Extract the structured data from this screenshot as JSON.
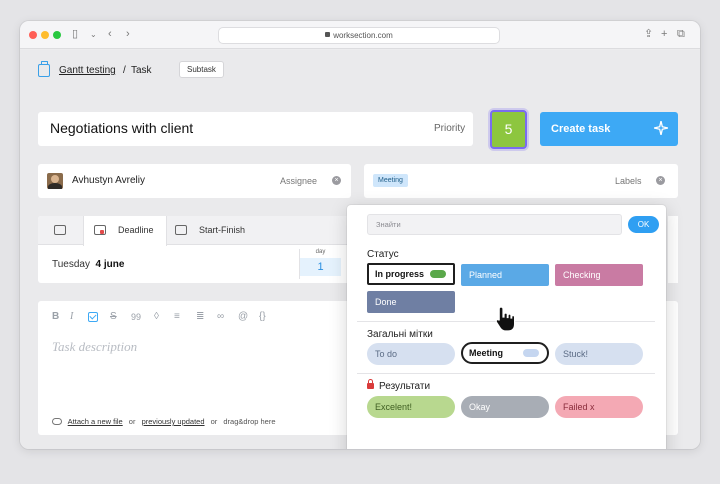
{
  "browser": {
    "url": "worksection.com"
  },
  "breadcrumb": {
    "project": "Gantt testing",
    "separator": "/",
    "current": "Task",
    "subtask_button": "Subtask"
  },
  "task": {
    "title": "Negotiations with client",
    "priority_label": "Priority",
    "priority_value": "5",
    "create_button": "Create task"
  },
  "assignee": {
    "name": "Avhustyn Avreliy",
    "hint": "Assignee"
  },
  "labels": {
    "selected": "Meeting",
    "hint": "Labels"
  },
  "deadline": {
    "tabs": [
      "",
      "Deadline",
      "Start-Finish"
    ],
    "date_weekday": "Tuesday",
    "date_value": "4 june",
    "day_label": "day",
    "day_value": "1"
  },
  "editor": {
    "toolbar": [
      "B",
      "I",
      "",
      "S",
      "99",
      "◊",
      "≡",
      "≣",
      "∞",
      "@",
      "{}"
    ],
    "placeholder": "Task description",
    "attach_link": "Attach a new file",
    "or1": "or",
    "previously_link": "previously updated",
    "or2": "or",
    "dragdrop": "drag&drop here"
  },
  "labels_dropdown": {
    "search_placeholder": "Знайти",
    "ok_button": "OK",
    "status_title": "Статус",
    "status_items": [
      {
        "label": "In progress",
        "color": "#ffffff",
        "selected": true
      },
      {
        "label": "Planned",
        "color": "#5aa9e6"
      },
      {
        "label": "Checking",
        "color": "#c97ba3"
      },
      {
        "label": "Done",
        "color": "#6f7fa3"
      }
    ],
    "general_title": "Загальні мітки",
    "general_items": [
      {
        "label": "To do",
        "color": "#d6e0f0"
      },
      {
        "label": "Meeting",
        "color": "#ffffff",
        "selected": true
      },
      {
        "label": "Stuck!",
        "color": "#d6e0f0"
      }
    ],
    "results_title": "Результати",
    "results_items": [
      {
        "label": "Excelent!",
        "color": "#b8d88f"
      },
      {
        "label": "Okay",
        "color": "#a8adb5"
      },
      {
        "label": "Failed x",
        "color": "#f4a9b4"
      }
    ]
  },
  "colors": {
    "accent": "#3da9f5",
    "priority": "#8dc63f",
    "toggle_green": "#5aa84a",
    "toggle_blue": "#c5d6f0"
  }
}
